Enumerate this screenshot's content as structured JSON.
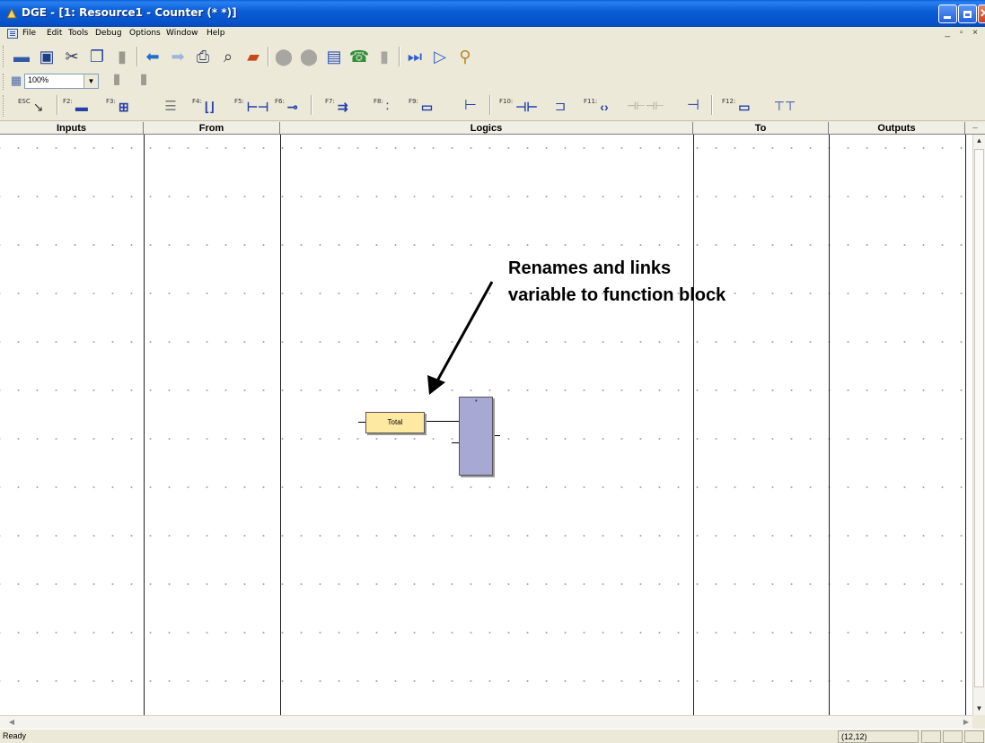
{
  "window": {
    "title": "DGE - [1: Resource1 - Counter (* *)]"
  },
  "menu": {
    "items": [
      "File",
      "Edit",
      "Tools",
      "Debug",
      "Options",
      "Window",
      "Help"
    ],
    "mdi_controls": "_ ▫ ×"
  },
  "toolbar": {
    "zoom_value": "100%"
  },
  "function_keys": {
    "esc": "ESC",
    "f2": "F2:",
    "f3": "F3:",
    "f4": "F4:",
    "f5": "F5:",
    "f6": "F6:",
    "f7": "F7:",
    "f8": "F8:",
    "f9": "F9:",
    "f10": "F10:",
    "f11": "F11:",
    "f12": "F12:"
  },
  "columns": {
    "inputs": "Inputs",
    "from": "From",
    "logics": "Logics",
    "to": "To",
    "outputs": "Outputs"
  },
  "diagram": {
    "variable_name": "Total",
    "block_marker": "*"
  },
  "annotation": {
    "line1": "Renames and links",
    "line2": "variable to function block"
  },
  "status": {
    "text": "Ready",
    "coordinates": "(12,12)"
  }
}
